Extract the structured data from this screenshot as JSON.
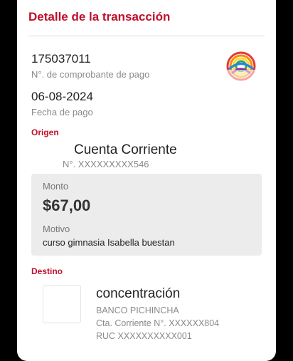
{
  "header": {
    "title": "Detalle de la transacción"
  },
  "payment": {
    "receipt_number": "175037011",
    "receipt_label": "N°. de comprobante de pago",
    "date": "06-08-2024",
    "date_label": "Fecha de pago"
  },
  "origin": {
    "section_label": "Origen",
    "account_type": "Cuenta Corriente",
    "account_number": "N°. XXXXXXXXX546"
  },
  "amount": {
    "label": "Monto",
    "value": "$67,00",
    "motivo_label": "Motivo",
    "motivo": "curso gimnasia Isabella buestan"
  },
  "destination": {
    "section_label": "Destino",
    "name": "concentración",
    "bank": "BANCO PICHINCHA",
    "account": "Cta. Corriente N°. XXXXXX804",
    "ruc": "RUC XXXXXXXXXX001"
  },
  "colors": {
    "accent": "#c0102a",
    "panel": "#ececec"
  },
  "icons": {
    "bank_logo": "multicolor-globe-logo-icon"
  }
}
